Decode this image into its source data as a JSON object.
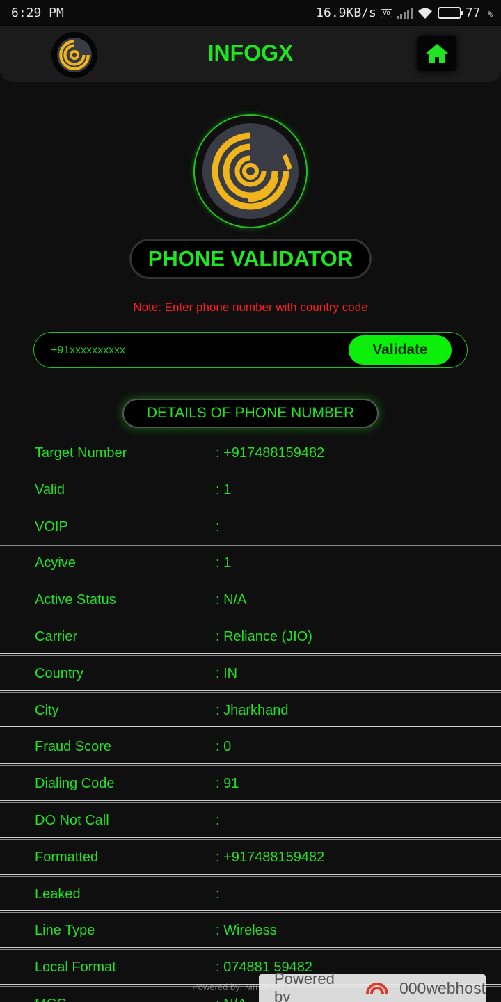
{
  "status_bar": {
    "time": "6:29 PM",
    "speed": "16.9KB/s",
    "volte": "Vo LTE",
    "network": "4G",
    "battery_percent": "77",
    "battery_unit": "%",
    "battery_level": 0.77
  },
  "app_bar": {
    "title": "INFOGX",
    "logo_icon": "infogx-logo-icon",
    "home_icon": "home-icon"
  },
  "hero": {
    "title": "PHONE VALIDATOR",
    "note": "Note: Enter phone number with country code"
  },
  "search": {
    "placeholder": "+91xxxxxxxxxx",
    "value": "",
    "button_label": "Validate"
  },
  "details": {
    "heading": "DETAILS OF PHONE NUMBER",
    "rows": [
      {
        "label": "Target Number",
        "value": ": +917488159482"
      },
      {
        "label": "Valid",
        "value": ": 1"
      },
      {
        "label": "VOIP",
        "value": ":"
      },
      {
        "label": "Acyive",
        "value": ": 1"
      },
      {
        "label": "Active Status",
        "value": ": N/A"
      },
      {
        "label": "Carrier",
        "value": ": Reliance (JIO)"
      },
      {
        "label": "Country",
        "value": ": IN"
      },
      {
        "label": "City",
        "value": ": Jharkhand"
      },
      {
        "label": "Fraud Score",
        "value": ": 0"
      },
      {
        "label": "Dialing Code",
        "value": ": 91"
      },
      {
        "label": "DO Not Call",
        "value": ":"
      },
      {
        "label": "Formatted",
        "value": ": +917488159482"
      },
      {
        "label": "Leaked",
        "value": ":"
      },
      {
        "label": "Line Type",
        "value": ": Wireless"
      },
      {
        "label": "Local Format",
        "value": ": 074881 59482"
      },
      {
        "label": "MCC",
        "value": ": N/A"
      }
    ]
  },
  "footer": {
    "powered_text": "Powered by: MrHacker X",
    "badge_prefix": "Powered by",
    "badge_brand": "000webhost"
  },
  "colors": {
    "accent": "#1ee620",
    "background": "#0f0f0f",
    "note": "#ff1e1e",
    "logo_gold": "#f0b51c"
  }
}
